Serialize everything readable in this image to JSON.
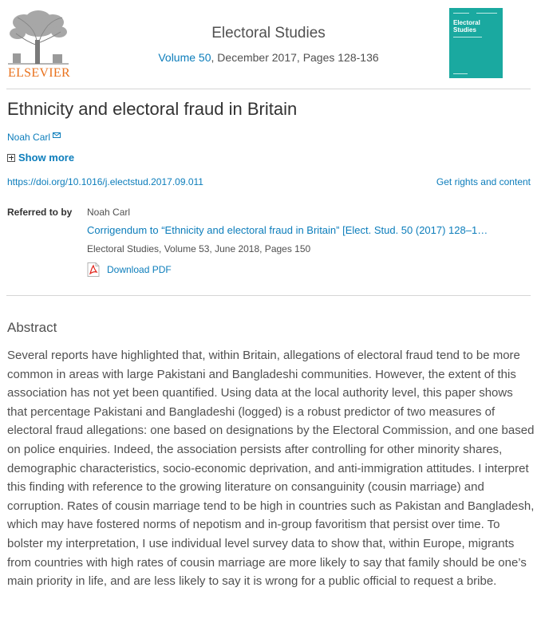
{
  "header": {
    "publisher_logo_text": "ELSEVIER",
    "journal_title": "Electoral Studies",
    "volume_link": "Volume 50",
    "issue_details": ", December 2017, Pages 128-136",
    "cover": {
      "title_line1": "Electoral",
      "title_line2": "Studies",
      "color": "#1aa9a0"
    }
  },
  "article": {
    "title": "Ethnicity and electoral fraud in Britain",
    "author": "Noah Carl",
    "show_more_label": "Show more",
    "doi": "https://doi.org/10.1016/j.electstud.2017.09.011",
    "rights_label": "Get rights and content"
  },
  "referred_to": {
    "label": "Referred to by",
    "author": "Noah Carl",
    "title": "Corrigendum to “Ethnicity and electoral fraud in Britain” [Elect. Stud. 50 (2017) 128–1…",
    "source": "Electoral Studies, Volume 53, June 2018, Pages 150",
    "download_label": "Download PDF"
  },
  "abstract": {
    "heading": "Abstract",
    "text": "Several reports have highlighted that, within Britain, allegations of electoral fraud tend to be more common in areas with large Pakistani and Bangladeshi communities. However, the extent of this association has not yet been quantified. Using data at the local authority level, this paper shows that percentage Pakistani and Bangladeshi (logged) is a robust predictor of two measures of electoral fraud allegations: one based on designations by the Electoral Commission, and one based on police enquiries. Indeed, the association persists after controlling for other minority shares, demographic characteristics, socio-economic deprivation, and anti-immigration attitudes. I interpret this finding with reference to the growing literature on consanguinity (cousin marriage) and corruption. Rates of cousin marriage tend to be high in countries such as Pakistan and Bangladesh, which may have fostered norms of nepotism and in-group favoritism that persist over time. To bolster my interpretation, I use individual level survey data to show that, within Europe, migrants from countries with high rates of cousin marriage are more likely to say that family should be one’s main priority in life, and are less likely to say it is wrong for a public official to request a bribe."
  },
  "colors": {
    "link": "#0c7dbb",
    "text": "#505050",
    "publisher_orange": "#e9711c"
  },
  "icons": {
    "mail": "envelope-icon",
    "expand": "plus-box-icon",
    "pdf": "pdf-file-icon",
    "logo": "elsevier-tree-logo"
  }
}
